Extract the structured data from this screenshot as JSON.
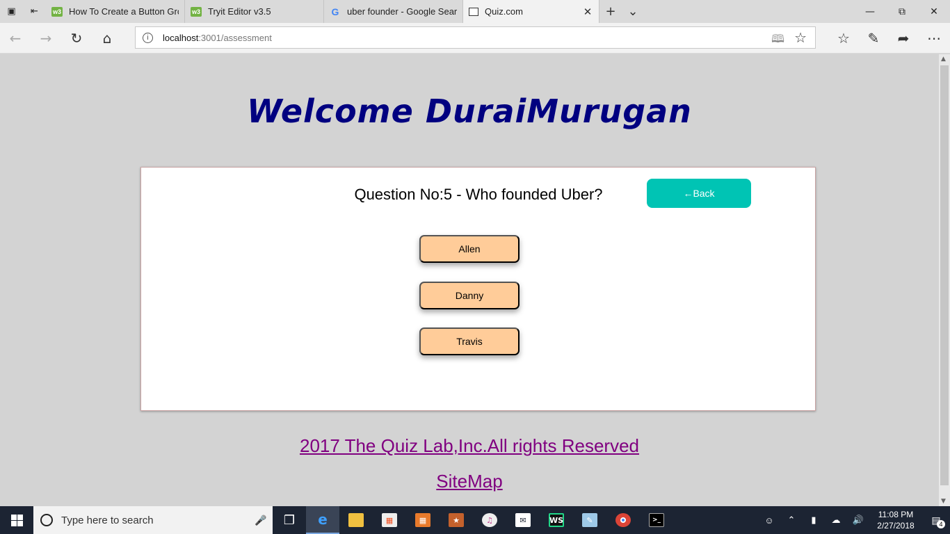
{
  "browser": {
    "tabs": [
      {
        "title": "How To Create a Button Grc",
        "favicon": "w3-icon"
      },
      {
        "title": "Tryit Editor v3.5",
        "favicon": "w3-icon"
      },
      {
        "title": "uber founder - Google Sear",
        "favicon": "google-icon"
      },
      {
        "title": "Quiz.com",
        "favicon": "page-icon",
        "active": true
      }
    ],
    "url_host": "localhost",
    "url_path": ":3001/assessment"
  },
  "page": {
    "welcome": "Welcome DuraiMurugan",
    "question": "Question No:5 - Who founded Uber?",
    "back_label": "←Back",
    "options": [
      "Allen",
      "Danny",
      "Travis"
    ],
    "copyright": "2017 The Quiz Lab,Inc.All rights Reserved",
    "sitemap": "SiteMap",
    "colors": {
      "welcome": "#000080",
      "back_button": "#00c4b4",
      "option_button": "#ffcc99",
      "footer_link": "#800080",
      "page_background": "#d3d3d3"
    }
  },
  "taskbar": {
    "search_placeholder": "Type here to search",
    "time": "11:08 PM",
    "date": "2/27/2018",
    "notification_count": "4"
  }
}
